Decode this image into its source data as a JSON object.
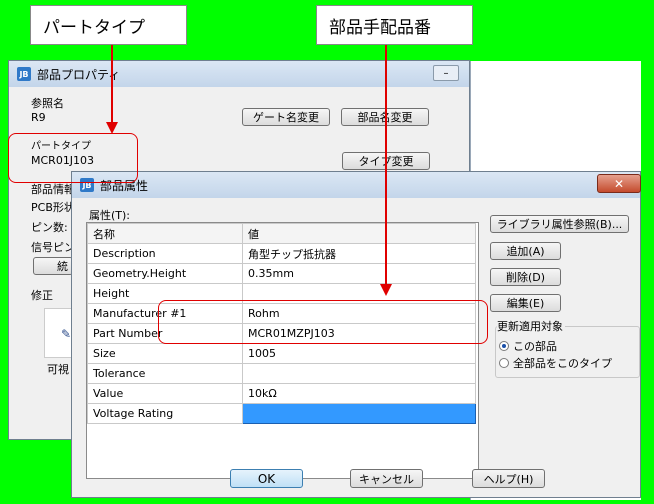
{
  "callouts": {
    "part_type": "パートタイプ",
    "part_number": "部品手配品番"
  },
  "back_window": {
    "title": "部品プロパティ",
    "ref_label": "参照名",
    "ref_value": "R9",
    "gate_button": "ゲート名変更",
    "part_name_button": "部品名変更",
    "part_type_label": "パートタイプ",
    "part_type_value": "MCR01J103",
    "type_change_button": "タイプ変更",
    "info_label": "部品情報",
    "pcb_label": "PCB形状",
    "pin_label": "ピン数:",
    "signal_label": "信号ピン",
    "stats_button": "統",
    "modify_label": "修正",
    "visible_label": "可視"
  },
  "front_window": {
    "title": "部品属性",
    "attr_label": "属性(T):",
    "headers": [
      "名称",
      "値"
    ],
    "rows": [
      {
        "name": "Description",
        "value": "角型チップ抵抗器"
      },
      {
        "name": "Geometry.Height",
        "value": "0.35mm"
      },
      {
        "name": "Height",
        "value": ""
      },
      {
        "name": "Manufacturer #1",
        "value": "Rohm"
      },
      {
        "name": "Part Number",
        "value": "MCR01MZPJ103"
      },
      {
        "name": "Size",
        "value": "1005"
      },
      {
        "name": "Tolerance",
        "value": ""
      },
      {
        "name": "Value",
        "value": "10kΩ"
      },
      {
        "name": "Voltage Rating",
        "value": ""
      }
    ],
    "library_button": "ライブラリ属性参照(B)...",
    "add_button": "追加(A)",
    "delete_button": "削除(D)",
    "edit_button": "編集(E)",
    "scope_label": "更新適用対象",
    "scope_options": [
      "この部品",
      "全部品をこのタイプ"
    ],
    "ok_button": "OK",
    "cancel_button": "キャンセル",
    "help_button": "ヘルプ(H)"
  },
  "colors": {
    "annotation": "#e00000",
    "selected_cell": "#3399ff",
    "background": "#00ff00"
  }
}
